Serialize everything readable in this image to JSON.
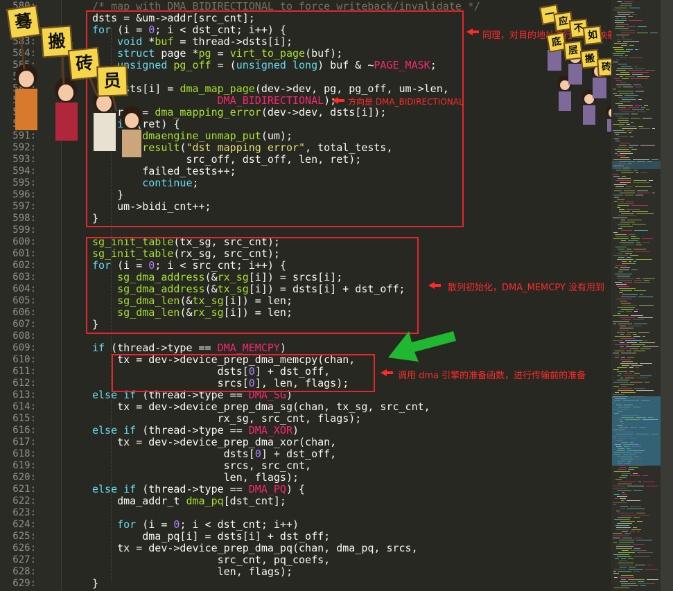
{
  "editor": {
    "lines": [
      {
        "num": "580:",
        "html": "<span class=\"c\">/* map with DMA_BIDIRECTIONAL to force writeback/invalidate */</span>"
      },
      {
        "num": "581:",
        "html": "dsts = &amp;um-&gt;addr[src_cnt];"
      },
      {
        "num": "582:",
        "html": "<span class=\"k\">for</span> (i = <span class=\"n\">0</span>; i &lt; dst_cnt; i++) {"
      },
      {
        "num": "583:",
        "html": "    <span class=\"k\">void</span> *<span class=\"g\">buf</span> = thread-&gt;dsts[i];"
      },
      {
        "num": "584:",
        "html": "    <span class=\"k\">struct</span> page *<span class=\"g\">pg</span> = <span class=\"g\">virt_to_page</span>(buf);"
      },
      {
        "num": "585:",
        "html": "    <span class=\"k\">unsigned</span> <span class=\"g\">pg_off</span> = (<span class=\"k\">unsigned long</span>) buf &amp; ~<span class=\"r\">PAGE_MASK</span>;"
      },
      {
        "num": "586:",
        "html": ""
      },
      {
        "num": "587:",
        "html": "    dsts[i] = <span class=\"g\">dma_map_page</span>(dev-&gt;dev, pg, pg_off, um-&gt;len,"
      },
      {
        "num": "588:",
        "html": "                    <span class=\"r\">DMA_BIDIRECTIONAL</span>);"
      },
      {
        "num": "589:",
        "html": "    ret = <span class=\"g\">dma_mapping_error</span>(dev-&gt;dev, dsts[i]);"
      },
      {
        "num": "590:",
        "html": "    <span class=\"k\">if</span> (ret) {"
      },
      {
        "num": "591:",
        "html": "        <span class=\"g\">dmaengine_unmap_put</span>(um);"
      },
      {
        "num": "592:",
        "html": "        <span class=\"g\">result</span>(<span class=\"s\">\"dst mapping error\"</span>, total_tests,"
      },
      {
        "num": "593:",
        "html": "               src_off, dst_off, len, ret);"
      },
      {
        "num": "594:",
        "html": "        failed_tests++;"
      },
      {
        "num": "595:",
        "html": "        <span class=\"k\">continue</span>;"
      },
      {
        "num": "596:",
        "html": "    }"
      },
      {
        "num": "597:",
        "html": "    um-&gt;bidi_cnt++;"
      },
      {
        "num": "598:",
        "html": "}"
      },
      {
        "num": "599:",
        "html": ""
      },
      {
        "num": "600:",
        "html": "<span class=\"g\">sg_init_table</span>(tx_sg, src_cnt);"
      },
      {
        "num": "601:",
        "html": "<span class=\"g\">sg_init_table</span>(rx_sg, src_cnt);"
      },
      {
        "num": "602:",
        "html": "<span class=\"k\">for</span> (i = <span class=\"n\">0</span>; i &lt; src_cnt; i++) {"
      },
      {
        "num": "603:",
        "html": "    <span class=\"g\">sg_dma_address</span>(&amp;<span class=\"g\">rx_sg</span>[i]) = srcs[i];"
      },
      {
        "num": "604:",
        "html": "    <span class=\"g\">sg_dma_address</span>(&amp;<span class=\"g\">tx_sg</span>[i]) = dsts[i] + dst_off;"
      },
      {
        "num": "605:",
        "html": "    <span class=\"g\">sg_dma_len</span>(&amp;<span class=\"g\">tx_sg</span>[i]) = len;"
      },
      {
        "num": "606:",
        "html": "    <span class=\"g\">sg_dma_len</span>(&amp;<span class=\"g\">rx_sg</span>[i]) = len;"
      },
      {
        "num": "607:",
        "html": "}"
      },
      {
        "num": "608:",
        "html": ""
      },
      {
        "num": "609:",
        "html": "<span class=\"k\">if</span> (thread-&gt;type == <span class=\"r\">DMA_MEMCPY</span>)"
      },
      {
        "num": "610:",
        "html": "    tx = dev-&gt;device_prep_dma_memcpy(chan,"
      },
      {
        "num": "611:",
        "html": "                    dsts[<span class=\"n\">0</span>] + dst_off,"
      },
      {
        "num": "612:",
        "html": "                    srcs[<span class=\"n\">0</span>], len, flags);"
      },
      {
        "num": "613:",
        "html": "<span class=\"k\">else if</span> (thread-&gt;type == <span class=\"r\">DMA_SG</span>)"
      },
      {
        "num": "614:",
        "html": "    tx = dev-&gt;device_prep_dma_sg(chan, tx_sg, src_cnt,"
      },
      {
        "num": "615:",
        "html": "                    rx_sg, src_cnt, flags);"
      },
      {
        "num": "616:",
        "html": "<span class=\"k\">else if</span> (thread-&gt;type == <span class=\"r\">DMA_XOR</span>)"
      },
      {
        "num": "617:",
        "html": "    tx = dev-&gt;device_prep_dma_xor(chan,"
      },
      {
        "num": "618:",
        "html": "                     dsts[<span class=\"n\">0</span>] + dst_off,"
      },
      {
        "num": "619:",
        "html": "                     srcs, src_cnt,"
      },
      {
        "num": "620:",
        "html": "                     len, flags);"
      },
      {
        "num": "621:",
        "html": "<span class=\"k\">else if</span> (thread-&gt;type == <span class=\"r\">DMA_PQ</span>) {"
      },
      {
        "num": "622:",
        "html": "    dma_addr_t <span class=\"g\">dma_pq</span>[dst_cnt];"
      },
      {
        "num": "623:",
        "html": ""
      },
      {
        "num": "624:",
        "html": "    <span class=\"k\">for</span> (i = <span class=\"n\">0</span>; i &lt; dst_cnt; i++)"
      },
      {
        "num": "625:",
        "html": "        dma_pq[i] = dsts[i] + dst_off;"
      },
      {
        "num": "626:",
        "html": "    tx = dev-&gt;device_prep_dma_pq(chan, dma_pq, srcs,"
      },
      {
        "num": "627:",
        "html": "                    src_cnt, pq_coefs,"
      },
      {
        "num": "628:",
        "html": "                    len, flags);"
      },
      {
        "num": "629:",
        "html": "}"
      }
    ]
  },
  "annotations": {
    "note1": "同理，对目的地址进行 dma 映射",
    "note2": "方向是 DMA_BIDIRECTIONAL",
    "note3": "散列初始化，DMA_MEMCPY 没有用到",
    "note4": "调用 dma 引擎的准备函数，进行传输前的准备"
  },
  "stickers": {
    "left_signs": [
      "蓦",
      "搬",
      "砖",
      "员"
    ],
    "right_signs": [
      "一",
      "应",
      "不",
      "如",
      "底",
      "层",
      "搬",
      "砖",
      "员"
    ]
  },
  "colors": {
    "background": "#272822",
    "highlight_box": "#e8242c",
    "annotation_text": "#ff2a2a",
    "green_arrow": "#1fb830"
  }
}
